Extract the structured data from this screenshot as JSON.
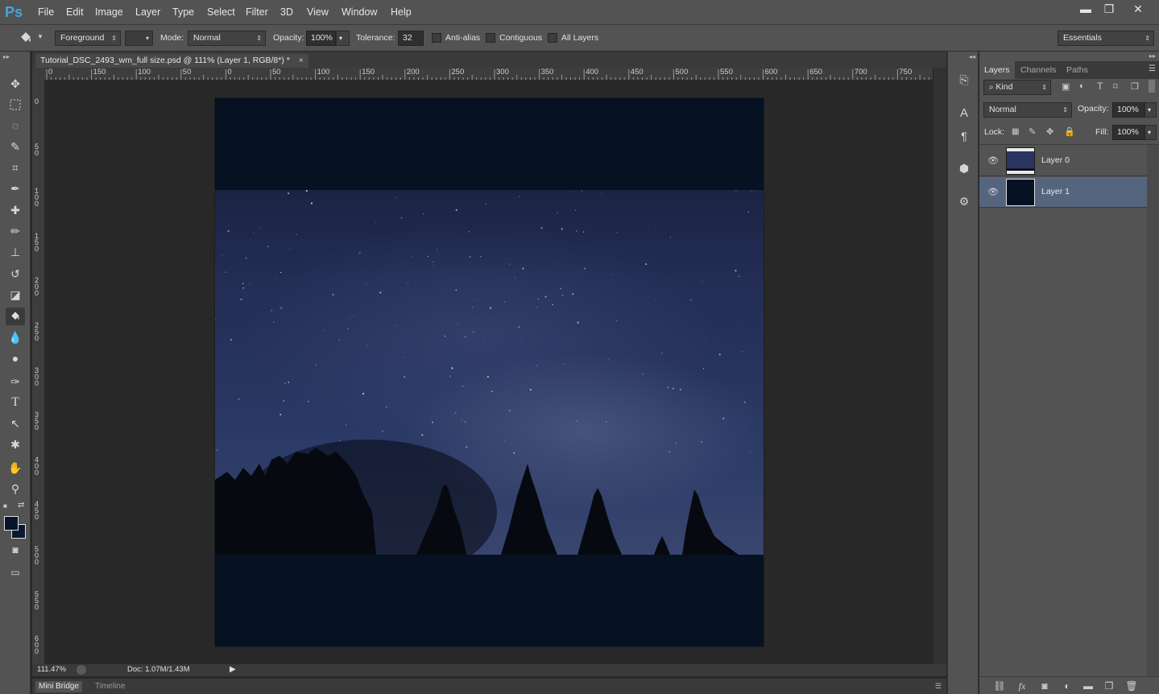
{
  "app": {
    "logo": "Ps"
  },
  "menu": [
    "File",
    "Edit",
    "Image",
    "Layer",
    "Type",
    "Select",
    "Filter",
    "3D",
    "View",
    "Window",
    "Help"
  ],
  "window_controls": {
    "minimize": "▬",
    "restore": "❐",
    "close": "✕"
  },
  "options": {
    "fill_source": "Foreground",
    "mode_label": "Mode:",
    "mode_value": "Normal",
    "opacity_label": "Opacity:",
    "opacity_value": "100%",
    "tolerance_label": "Tolerance:",
    "tolerance_value": "32",
    "antialias_label": "Anti-alias",
    "contiguous_label": "Contiguous",
    "all_layers_label": "All Layers",
    "workspace": "Essentials"
  },
  "document": {
    "tab_title": "Tutorial_DSC_2493_wm_full size.psd @ 111% (Layer 1, RGB/8*) *",
    "close": "×"
  },
  "rulers": {
    "horizontal": [
      "0",
      "150",
      "100",
      "50",
      "0",
      "50",
      "100",
      "150",
      "200",
      "250",
      "300",
      "350",
      "400",
      "450",
      "500",
      "550",
      "600",
      "650",
      "700",
      "750"
    ],
    "vertical": [
      "0",
      "50",
      "100",
      "150",
      "200",
      "250",
      "300",
      "350",
      "400",
      "450",
      "500",
      "550",
      "600"
    ]
  },
  "status": {
    "zoom": "111.47%",
    "doc": "Doc: 1.07M/1.43M"
  },
  "bottom_tabs": [
    "Mini Bridge",
    "Timeline"
  ],
  "layers_panel": {
    "tabs": [
      "Layers",
      "Channels",
      "Paths"
    ],
    "filter_kind": "Kind",
    "blend_mode": "Normal",
    "opacity_label": "Opacity:",
    "opacity_value": "100%",
    "lock_label": "Lock:",
    "fill_label": "Fill:",
    "fill_value": "100%",
    "layers": [
      {
        "name": "Layer 0",
        "selected": false
      },
      {
        "name": "Layer 1",
        "selected": true
      }
    ]
  },
  "colors": {
    "accent": "#4aa3df",
    "selected_layer": "#56657e",
    "canvas_fill": "#061122"
  }
}
